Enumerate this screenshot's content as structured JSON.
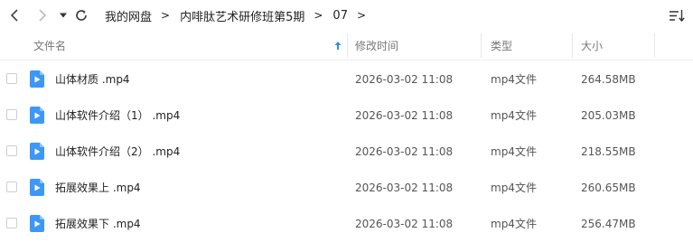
{
  "breadcrumb": {
    "items": [
      "我的网盘",
      "内啡肽艺术研修班第5期",
      "07"
    ]
  },
  "columns": {
    "name": "文件名",
    "modified": "修改时间",
    "type": "类型",
    "size": "大小"
  },
  "icons": {
    "back": "chevron-left-icon",
    "forward": "chevron-right-icon",
    "history": "caret-down-icon",
    "refresh": "refresh-icon",
    "sort": "sort-list-icon",
    "file": "video-file-icon",
    "sort_indicator": "arrow-up-icon"
  },
  "colors": {
    "accent": "#2f8ff0",
    "file_icon": "#3d98f5"
  },
  "files": [
    {
      "name": "山体材质 .mp4",
      "modified": "2026-03-02 11:08",
      "type": "mp4文件",
      "size": "264.58MB"
    },
    {
      "name": "山体软件介绍（1） .mp4",
      "modified": "2026-03-02 11:08",
      "type": "mp4文件",
      "size": "205.03MB"
    },
    {
      "name": "山体软件介绍（2） .mp4",
      "modified": "2026-03-02 11:08",
      "type": "mp4文件",
      "size": "218.55MB"
    },
    {
      "name": "拓展效果上 .mp4",
      "modified": "2026-03-02 11:08",
      "type": "mp4文件",
      "size": "260.65MB"
    },
    {
      "name": "拓展效果下 .mp4",
      "modified": "2026-03-02 11:08",
      "type": "mp4文件",
      "size": "256.47MB"
    }
  ]
}
